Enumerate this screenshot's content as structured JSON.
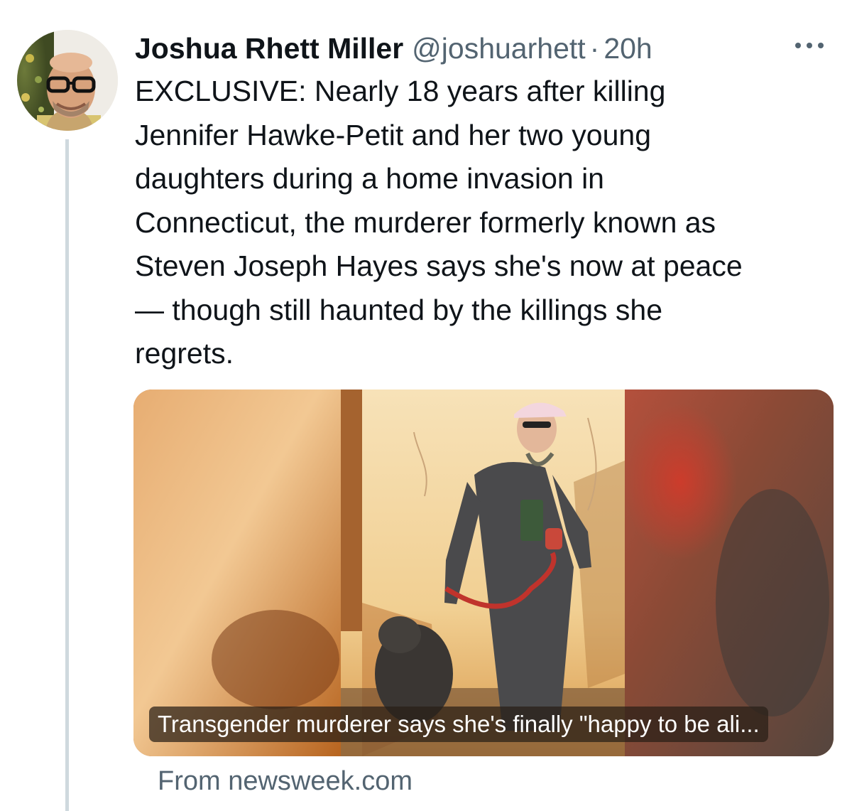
{
  "author": {
    "display_name": "Joshua Rhett Miller",
    "handle": "@joshuarhett",
    "separator": "·",
    "time": "20h"
  },
  "tweet": {
    "text": "EXCLUSIVE: Nearly 18 years after killing\nJennifer Hawke-Petit and her two young\ndaughters during a home invasion in\nConnecticut, the murderer formerly known as\nSteven Joseph Hayes says she's now at peace\n— though still haunted by the killings she\nregrets."
  },
  "card": {
    "caption": "Transgender murderer says she's finally \"happy to be ali...",
    "source": "From newsweek.com"
  },
  "icons": {
    "more": "more-options-icon",
    "avatar": "avatar"
  },
  "colors": {
    "text_primary": "#0f1419",
    "text_secondary": "#536471",
    "thread_line": "#cfd9de"
  }
}
